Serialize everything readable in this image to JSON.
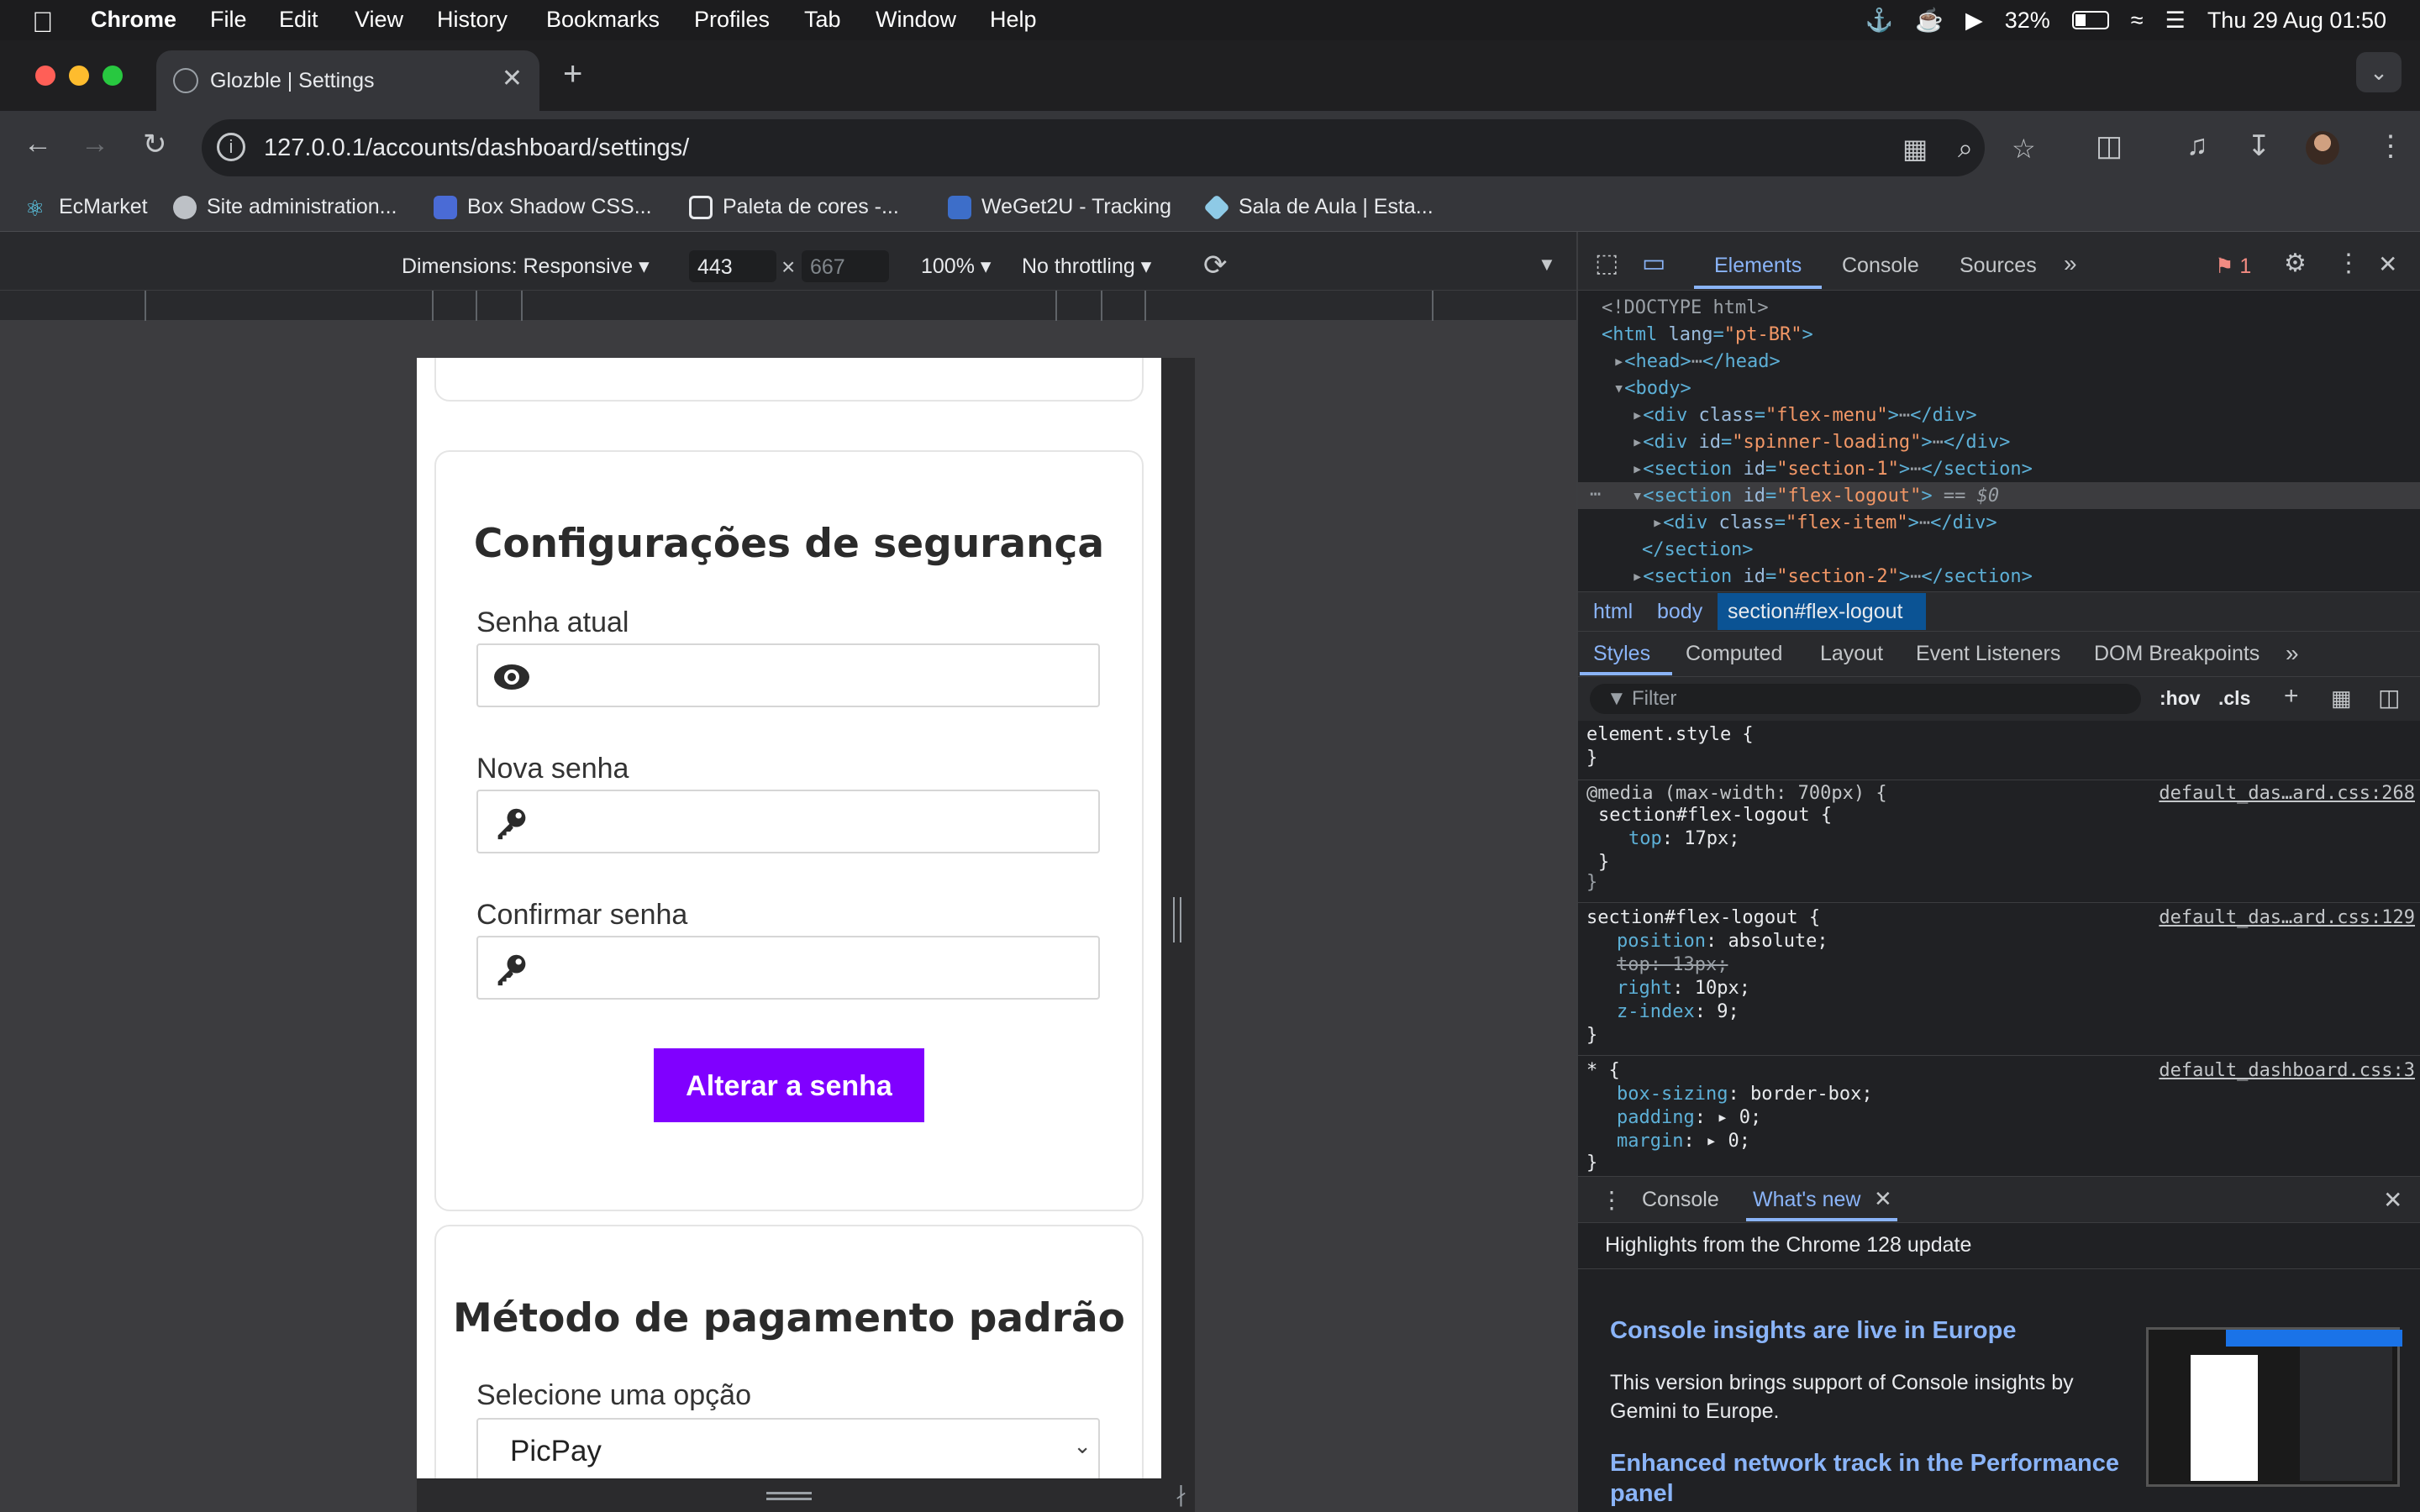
{
  "menubar": {
    "app": "Chrome",
    "items": [
      "File",
      "Edit",
      "View",
      "History",
      "Bookmarks",
      "Profiles",
      "Tab",
      "Window",
      "Help"
    ],
    "battery": "32%",
    "datetime": "Thu 29 Aug  01:50"
  },
  "browser": {
    "tab_title": "Glozble | Settings",
    "url": "127.0.0.1/accounts/dashboard/settings/",
    "bookmarks": [
      "EcMarket",
      "Site administration...",
      "Box Shadow CSS...",
      "Paleta de cores -...",
      "WeGet2U - Tracking",
      "Sala de Aula | Esta..."
    ]
  },
  "device_toolbar": {
    "dimensions_label": "Dimensions: Responsive ▾",
    "width": "443",
    "height": "667",
    "times": "×",
    "zoom": "100% ▾",
    "throttling": "No throttling ▾"
  },
  "page": {
    "security_title": "Configurações de segurança",
    "current_password_label": "Senha atual",
    "new_password_label": "Nova senha",
    "confirm_password_label": "Confirmar senha",
    "change_password_button": "Alterar a senha",
    "payment_title": "Método de pagamento padrão",
    "payment_select_label": "Selecione uma opção",
    "payment_selected": "PicPay"
  },
  "devtools": {
    "tabs": [
      "Elements",
      "Console",
      "Sources"
    ],
    "issues_count": "1",
    "dom": {
      "doctype": "<!DOCTYPE html>",
      "lang": "\"pt-BR\"",
      "class_flex_menu": "\"flex-menu\"",
      "id_spinner": "\"spinner-loading\"",
      "id_section1": "\"section-1\"",
      "id_flex_logout": "\"flex-logout\"",
      "selected_marker": "== $0",
      "class_flex_item": "\"flex-item\"",
      "id_section2": "\"section-2\""
    },
    "breadcrumb": [
      "html",
      "body",
      "section#flex-logout"
    ],
    "styles_tabs": [
      "Styles",
      "Computed",
      "Layout",
      "Event Listeners",
      "DOM Breakpoints"
    ],
    "filter_placeholder": "Filter",
    "hov": ":hov",
    "cls": ".cls",
    "rules": {
      "element_style": "element.style {",
      "media": "@media (max-width: 700px) {",
      "media_src": "default_das…ard.css:268",
      "media_selector": "section#flex-logout {",
      "media_top": "17px;",
      "rule_selector": "section#flex-logout {",
      "rule_src": "default_das…ard.css:129",
      "position": "absolute;",
      "top_struck": "top: 13px;",
      "right": "10px;",
      "zindex": "9;",
      "universal": "* {",
      "universal_src": "default_dashboard.css:3",
      "box_sizing": "border-box;",
      "padding": "0;",
      "margin": "0;"
    },
    "drawer_tabs": [
      "Console",
      "What's new"
    ],
    "whats_new": {
      "highlights": "Highlights from the Chrome 128 update",
      "h1": "Console insights are live in Europe",
      "p1_line1": "This version brings support of Console insights by",
      "p1_line2": "Gemini to Europe.",
      "h2_line1": "Enhanced network track in the Performance",
      "h2_line2": "panel"
    }
  },
  "colors": {
    "accent_button": "#8000ff",
    "devtools_bg": "#202124",
    "link_blue": "#8ab4f8"
  }
}
